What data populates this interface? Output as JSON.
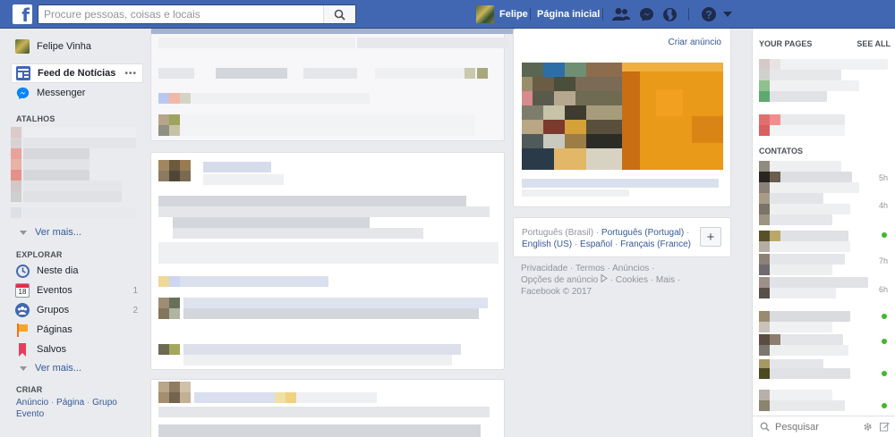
{
  "colors": {
    "brand": "#4267b2",
    "link": "#365899",
    "online": "#42b72a",
    "page_bg": "#e9ebee"
  },
  "topbar": {
    "logo_letter": "f",
    "search_placeholder": "Procure pessoas, coisas e locais",
    "profile_name": "Felipe",
    "home_label": "Página inicial",
    "icons": [
      "friend-requests-icon",
      "messenger-icon",
      "notifications-globe-icon",
      "help-icon",
      "account-menu-icon"
    ]
  },
  "leftnav": {
    "user_name": "Felipe Vinha",
    "feed_label": "Feed de Notícias",
    "feed_more": "•••",
    "messenger_label": "Messenger",
    "shortcuts_title": "ATALHOS",
    "see_more": "Ver mais...",
    "explore_title": "EXPLORAR",
    "explore_items": [
      {
        "label": "Neste dia",
        "count": "",
        "icon": "on-this-day-icon"
      },
      {
        "label": "Eventos",
        "count": "1",
        "icon": "events-calendar-icon"
      },
      {
        "label": "Grupos",
        "count": "2",
        "icon": "groups-icon"
      },
      {
        "label": "Páginas",
        "count": "",
        "icon": "pages-flag-icon"
      },
      {
        "label": "Salvos",
        "count": "",
        "icon": "saved-bookmark-icon"
      }
    ],
    "calendar_day": "18",
    "create_title": "CRIAR",
    "create_links": [
      "Anúncio",
      "Página",
      "Grupo",
      "Evento"
    ]
  },
  "rightcol": {
    "create_ad": "Criar anúncio",
    "languages": {
      "current": "Português (Brasil)",
      "others": [
        "Português (Portugal)",
        "English (US)",
        "Español",
        "Français (France)"
      ],
      "add": "+"
    },
    "footer": {
      "links": [
        "Privacidade",
        "Termos",
        "Anúncios",
        "Opções de anúncio",
        "Cookies",
        "Mais"
      ],
      "copyright": "Facebook © 2017"
    }
  },
  "chat": {
    "pages_title": "YOUR PAGES",
    "see_all": "SEE ALL",
    "contacts_title": "CONTATOS",
    "times": [
      "5h",
      "4h",
      "7h",
      "6h"
    ],
    "search_placeholder": "Pesquisar"
  }
}
